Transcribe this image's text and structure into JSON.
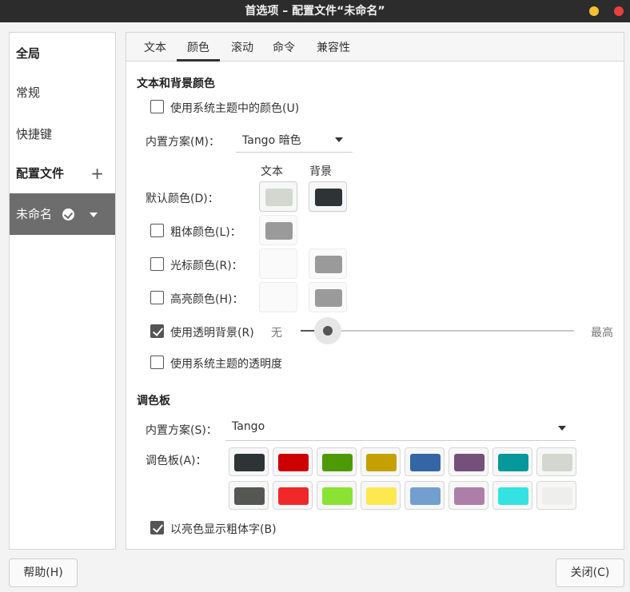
{
  "window": {
    "title": "首选项 – 配置文件“未命名”"
  },
  "sidebar": {
    "global": "全局",
    "general": "常规",
    "shortcuts": "快捷键",
    "profiles": "配置文件",
    "profile_name": "未命名"
  },
  "tabs": [
    "文本",
    "颜色",
    "滚动",
    "命令",
    "兼容性"
  ],
  "active_tab": "颜色",
  "colors": {
    "section_title": "文本和背景颜色",
    "use_system_colors": {
      "label": "使用系统主题中的颜色(U)",
      "checked": false
    },
    "builtin_scheme_label": "内置方案(M)：",
    "builtin_scheme_value": "Tango 暗色",
    "col_text": "文本",
    "col_bg": "背景",
    "default_color": {
      "label": "默认颜色(D)：",
      "text": "#d3d7cf",
      "bg": "#2e3436"
    },
    "bold_color": {
      "label": "粗体颜色(L)：",
      "checked": false,
      "text": "#9a9a9a"
    },
    "cursor_color": {
      "label": "光标颜色(R)：",
      "checked": false,
      "text": "#fafafa",
      "bg": "#9a9a9a"
    },
    "highlight_color": {
      "label": "高亮颜色(H)：",
      "checked": false,
      "text": "#fafafa",
      "bg": "#9a9a9a"
    },
    "transparent_bg": {
      "label": "使用透明背景(R)",
      "checked": true,
      "min_label": "无",
      "max_label": "最高",
      "value": 0.1
    },
    "system_transparency": {
      "label": "使用系统主题的透明度",
      "checked": false
    }
  },
  "palette": {
    "section_title": "调色板",
    "builtin_scheme_label": "内置方案(S)：",
    "builtin_scheme_value": "Tango",
    "palette_label": "调色板(A)：",
    "row1": [
      "#2e3436",
      "#cc0000",
      "#4e9a06",
      "#c4a000",
      "#3465a4",
      "#75507b",
      "#06989a",
      "#d3d7cf"
    ],
    "row2": [
      "#555753",
      "#ef2929",
      "#8ae234",
      "#fce94f",
      "#729fcf",
      "#ad7fa8",
      "#34e2e2",
      "#eeeeec"
    ],
    "bold_bright": {
      "label": "以亮色显示粗体字(B)",
      "checked": true
    }
  },
  "footer": {
    "help": "帮助(H)",
    "close": "关闭(C)"
  }
}
